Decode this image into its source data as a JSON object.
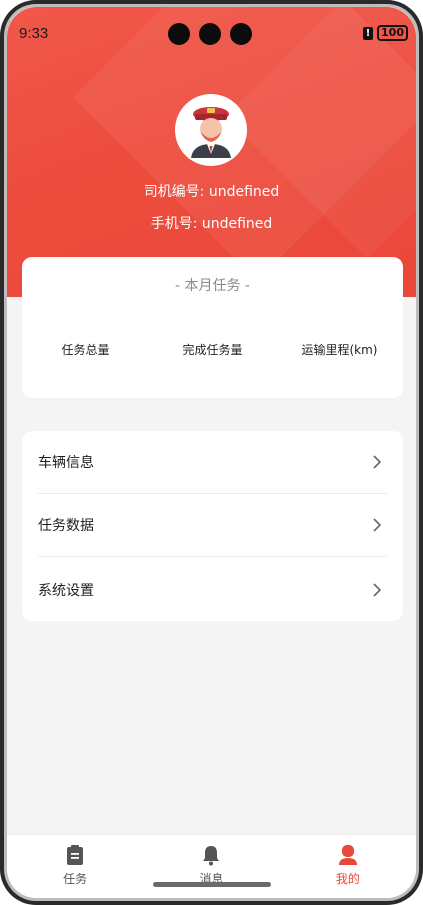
{
  "status_bar": {
    "time": "9:33",
    "battery": "100"
  },
  "profile": {
    "driver_id": "司机编号: undefined",
    "phone": "手机号: undefined"
  },
  "task_card": {
    "title": "- 本月任务 -",
    "stats": [
      "任务总量",
      "完成任务量",
      "运输里程(km)"
    ]
  },
  "menu": {
    "items": [
      {
        "label": "车辆信息",
        "icon": "chevron-right-icon"
      },
      {
        "label": "任务数据",
        "icon": "chevron-right-icon"
      },
      {
        "label": "系统设置",
        "icon": "chevron-right-icon"
      }
    ]
  },
  "tabbar": {
    "tabs": [
      {
        "label": "任务",
        "icon": "clipboard-icon"
      },
      {
        "label": "消息",
        "icon": "bell-icon"
      },
      {
        "label": "我的",
        "icon": "user-icon"
      }
    ],
    "active_color": "#e8473a"
  },
  "colors": {
    "header_red": "#ee4c3d",
    "background": "#f4f4f4"
  }
}
